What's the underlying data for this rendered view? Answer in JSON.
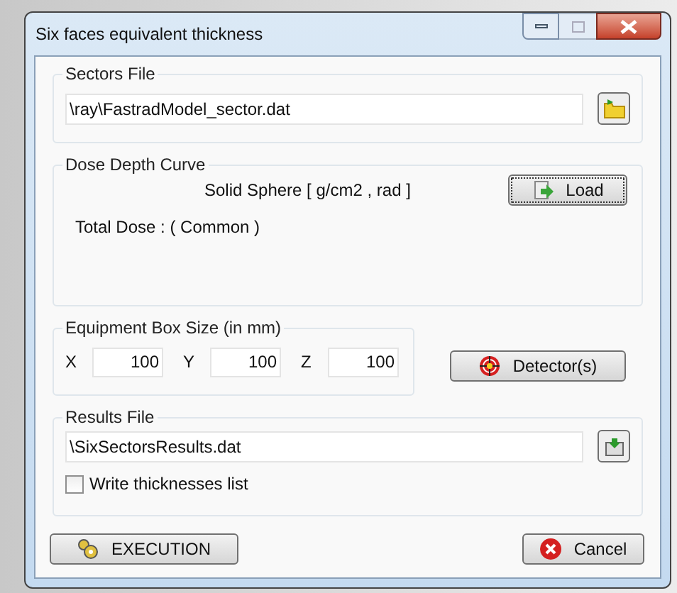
{
  "window": {
    "title": "Six faces equivalent thickness"
  },
  "sectors_file": {
    "label": "Sectors File",
    "value": "\\ray\\FastradModel_sector.dat"
  },
  "dose_depth_curve": {
    "label": "Dose Depth Curve",
    "unit_label": "Solid Sphere [ g/cm2 , rad ]",
    "load_button": "Load",
    "total_dose": "Total Dose : ( Common )"
  },
  "equipment_box": {
    "label": "Equipment Box Size (in mm)",
    "fields": [
      {
        "axis": "X",
        "value": "100"
      },
      {
        "axis": "Y",
        "value": "100"
      },
      {
        "axis": "Z",
        "value": "100"
      }
    ]
  },
  "detector_button": "Detector(s)",
  "results_file": {
    "label": "Results File",
    "value": "\\SixSectorsResults.dat",
    "write_list": {
      "label": "Write thicknesses list",
      "checked": false
    }
  },
  "execution_button": "EXECUTION",
  "cancel_button": "Cancel"
}
